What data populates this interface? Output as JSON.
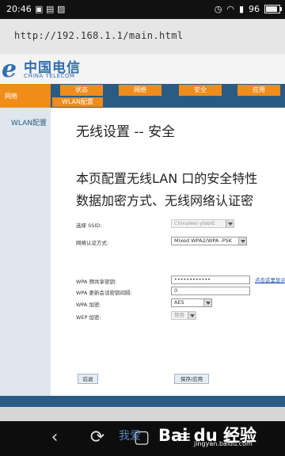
{
  "statusbar": {
    "time": "20:46",
    "battery": "96"
  },
  "browser": {
    "url": "http://192.168.1.1/main.html"
  },
  "brand": {
    "cn": "中国电信",
    "en": "CHINA TELECOM"
  },
  "nav": {
    "section": "网络",
    "tabs": [
      "状态",
      "网络",
      "安全",
      "应用"
    ],
    "subtab": "WLAN配置"
  },
  "sidebar": {
    "item": "WLAN配置"
  },
  "content": {
    "title": "无线设置 -- 安全",
    "desc_line1": "本页配置无线LAN 口的安全特性",
    "desc_line2": "数据加密方式、无线网络认证密"
  },
  "form": {
    "ssid_label": "选择 SSID:",
    "ssid_value": "ChinaNet-ylabiE",
    "auth_label": "网络认证方式:",
    "auth_value": "Mixed WPA2/WPA -PSK",
    "psk_label": "WPA 预共享密钥:",
    "psk_value": "••••••••••••",
    "psk_link": "点击这里显示",
    "interval_label": "WPA 更新会话密钥间隔:",
    "interval_value": "0",
    "wpa_enc_label": "WPA 加密:",
    "wpa_enc_value": "AES",
    "wep_enc_label": "WEP 加密:",
    "wep_enc_value": "禁用",
    "back_button": "后退",
    "save_button": "保存/应用"
  },
  "watermark": {
    "text": "Bai du 经验",
    "url": "jingyan.baidu.com",
    "alt": "我爱"
  }
}
